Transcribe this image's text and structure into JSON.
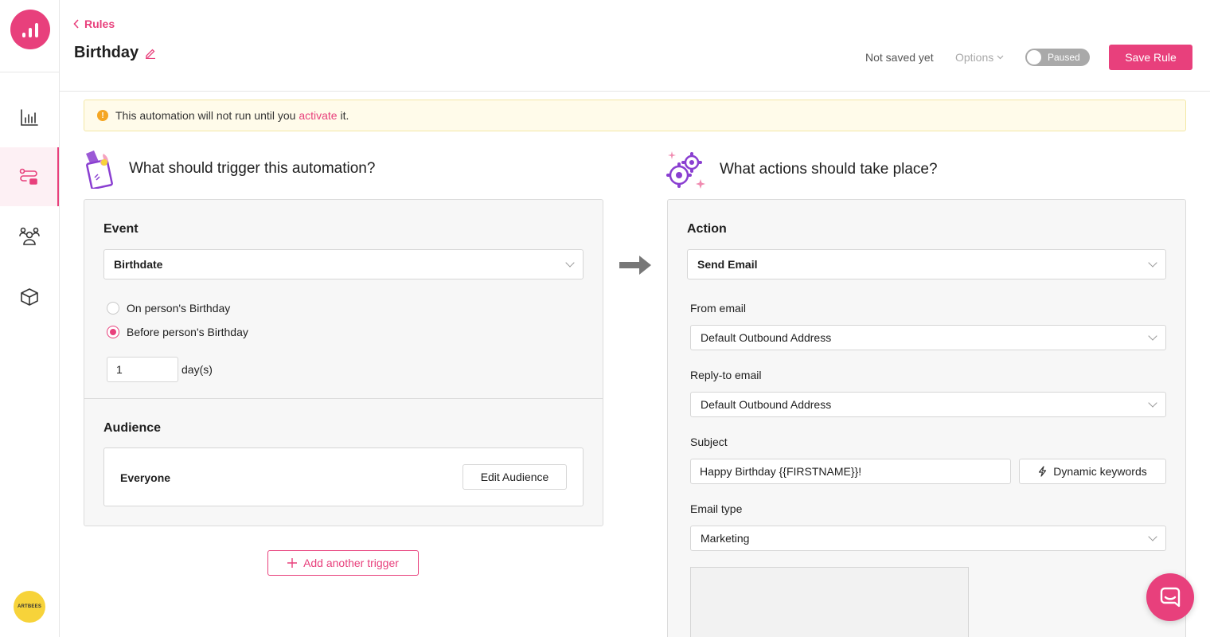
{
  "colors": {
    "accent": "#e8407c",
    "alert_bg": "#fffbea",
    "toggle_off": "#a9a9a9"
  },
  "sidebar": {
    "logo_icon": "bar-chart-logo-icon",
    "items": [
      {
        "icon": "analytics-icon",
        "active": false
      },
      {
        "icon": "automation-icon",
        "active": true
      },
      {
        "icon": "people-icon",
        "active": false
      },
      {
        "icon": "box-icon",
        "active": false
      }
    ],
    "avatar_text": "ARTBEES"
  },
  "header": {
    "back_label": "Rules",
    "title": "Birthday",
    "save_status": "Not saved yet",
    "options_label": "Options",
    "toggle_label": "Paused",
    "save_label": "Save Rule"
  },
  "alert": {
    "text_before": "This automation will not run until you ",
    "link": "activate",
    "text_after": " it."
  },
  "trigger": {
    "heading": "What should trigger this automation?",
    "event_label": "Event",
    "event_value": "Birthdate",
    "radio_options": [
      "On person's Birthday",
      "Before person's Birthday"
    ],
    "selected_radio": 1,
    "days_value": "1",
    "days_unit": "day(s)",
    "audience_label": "Audience",
    "audience_value": "Everyone",
    "edit_audience": "Edit Audience",
    "add_trigger": "Add another trigger"
  },
  "action": {
    "heading": "What actions should take place?",
    "action_label": "Action",
    "action_value": "Send Email",
    "from_label": "From email",
    "from_value": "Default Outbound Address",
    "reply_label": "Reply-to email",
    "reply_value": "Default Outbound Address",
    "subject_label": "Subject",
    "subject_value": "Happy Birthday {{FIRSTNAME}}!",
    "dynamic_keywords": "Dynamic keywords",
    "email_type_label": "Email type",
    "email_type_value": "Marketing"
  }
}
